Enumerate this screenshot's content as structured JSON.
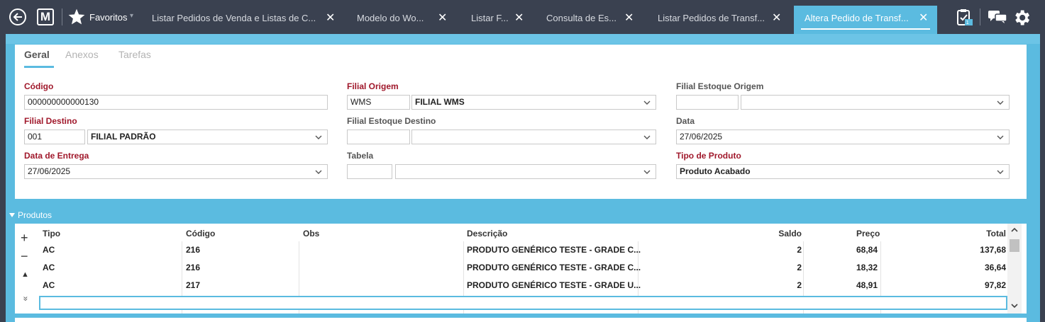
{
  "topbar": {
    "favorites_label": "Favoritos",
    "favorites_caret": "▾",
    "logo_letter": "M",
    "tabs": [
      {
        "label": "Listar Pedidos de Venda e Listas de C...",
        "close": "✕"
      },
      {
        "label": "Modelo do Wo...",
        "close": "✕"
      },
      {
        "label": "Listar F...",
        "close": "✕"
      },
      {
        "label": "Consulta de Es...",
        "close": "✕"
      },
      {
        "label": "Listar Pedidos de Transf...",
        "close": "✕"
      },
      {
        "label": "Altera Pedido de Transf...",
        "close": "✕"
      }
    ],
    "active_tab_index": 5,
    "accent": "#5bbbe0"
  },
  "subtabs": [
    "Geral",
    "Anexos",
    "Tarefas"
  ],
  "form": {
    "codigo": {
      "label": "Código",
      "value": "000000000000130"
    },
    "filial_origem": {
      "label": "Filial Origem",
      "code": "WMS",
      "name": "FILIAL WMS"
    },
    "filial_estoque_origem": {
      "label": "Filial Estoque Origem",
      "code": "",
      "name": ""
    },
    "filial_destino": {
      "label": "Filial Destino",
      "code": "001",
      "name": "FILIAL PADRÃO"
    },
    "filial_estoque_destino": {
      "label": "Filial Estoque Destino",
      "code": "",
      "name": ""
    },
    "data": {
      "label": "Data",
      "value": "27/06/2025"
    },
    "data_entrega": {
      "label": "Data de Entrega",
      "value": "27/06/2025"
    },
    "tabela": {
      "label": "Tabela",
      "code": "",
      "name": ""
    },
    "tipo_produto": {
      "label": "Tipo de Produto",
      "value": "Produto Acabado"
    }
  },
  "produtos": {
    "title": "Produtos",
    "columns": [
      "Tipo",
      "Código",
      "Obs",
      "Descrição",
      "Saldo",
      "Preço",
      "Total"
    ],
    "rows": [
      {
        "tipo": "AC",
        "codigo": "216",
        "obs": "",
        "descricao": "PRODUTO GENÉRICO TESTE - GRADE C...",
        "saldo": "2",
        "preco": "68,84",
        "total": "137,68"
      },
      {
        "tipo": "AC",
        "codigo": "216",
        "obs": "",
        "descricao": "PRODUTO GENÉRICO TESTE - GRADE C...",
        "saldo": "2",
        "preco": "18,32",
        "total": "36,64"
      },
      {
        "tipo": "AC",
        "codigo": "217",
        "obs": "",
        "descricao": "PRODUTO GENÉRICO TESTE - GRADE U...",
        "saldo": "2",
        "preco": "48,91",
        "total": "97,82"
      }
    ],
    "tools": {
      "add": "+",
      "remove": "−",
      "up": "▲",
      "more": "»"
    }
  }
}
